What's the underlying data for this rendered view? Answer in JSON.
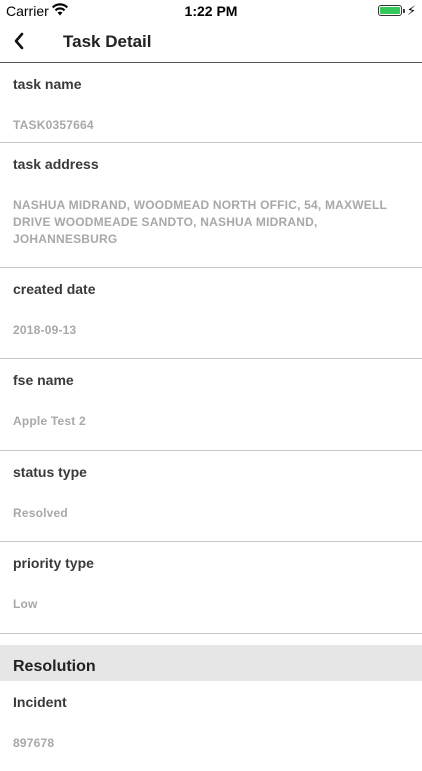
{
  "status_bar": {
    "carrier": "Carrier",
    "time": "1:22 PM",
    "icons": [
      "wifi-icon",
      "battery-icon",
      "charging-bolt-icon"
    ],
    "battery_color": "#34c759"
  },
  "nav": {
    "title": "Task Detail",
    "back_icon": "chevron-left-icon"
  },
  "fields": [
    {
      "label": "task name",
      "value": "TASK0357664"
    },
    {
      "label": "task address",
      "value": "NASHUA MIDRAND, WOODMEAD NORTH OFFIC, 54, MAXWELL DRIVE WOODMEADE SANDTO, NASHUA MIDRAND, JOHANNESBURG"
    },
    {
      "label": "created date",
      "value": "2018-09-13"
    },
    {
      "label": "fse name",
      "value": "Apple Test 2"
    },
    {
      "label": "status type",
      "value": "Resolved"
    },
    {
      "label": "priority type",
      "value": "Low"
    }
  ],
  "resolution_section": {
    "title": "Resolution",
    "fields": [
      {
        "label": "Incident",
        "value": "897678"
      }
    ]
  }
}
